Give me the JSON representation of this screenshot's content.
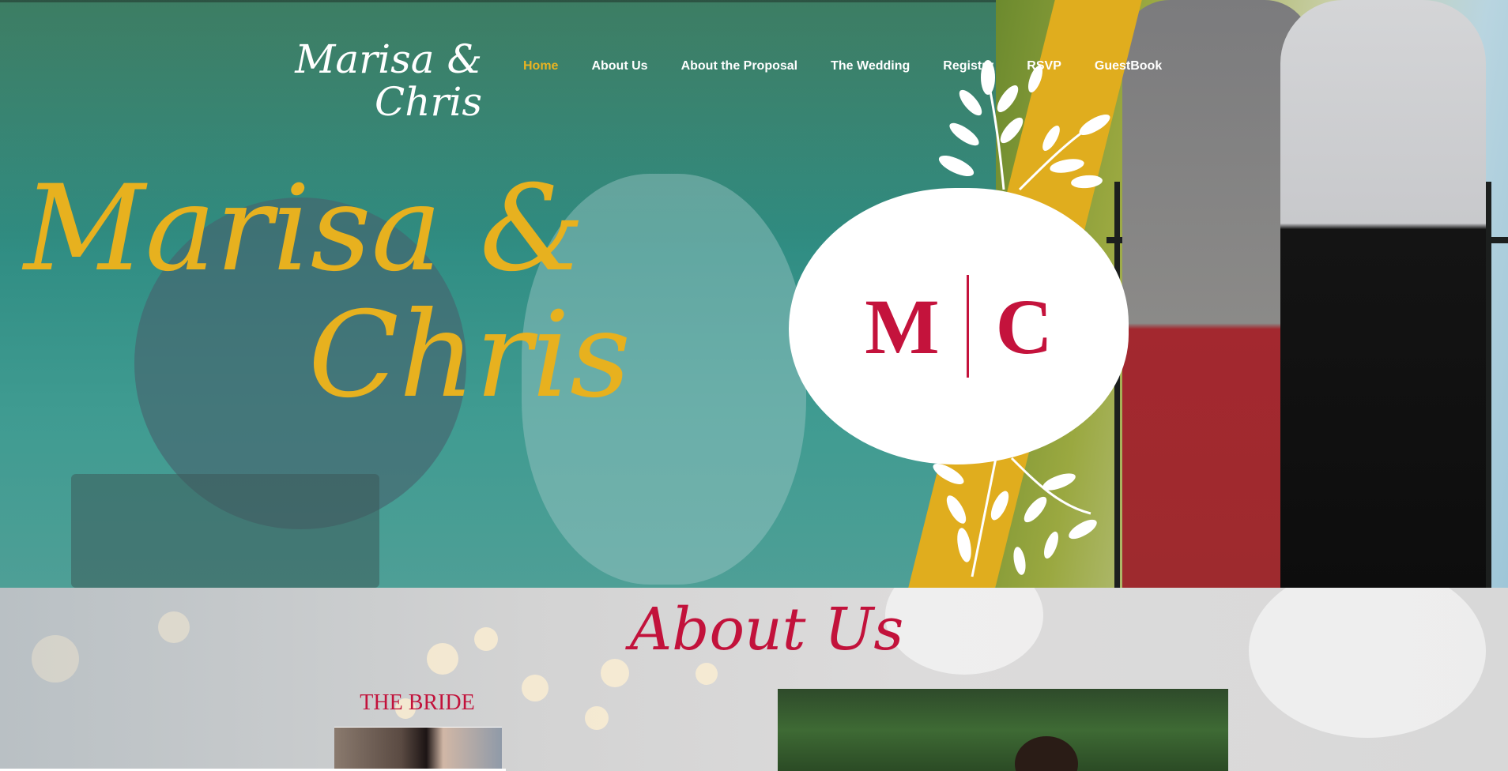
{
  "site": {
    "logo_text_line1": "Marisa &",
    "logo_text_line2": "Chris"
  },
  "nav": {
    "items": [
      {
        "label": "Home",
        "active": true
      },
      {
        "label": "About Us",
        "active": false
      },
      {
        "label": "About the Proposal",
        "active": false
      },
      {
        "label": "The Wedding",
        "active": false
      },
      {
        "label": "Registry",
        "active": false
      },
      {
        "label": "RSVP",
        "active": false
      },
      {
        "label": "GuestBook",
        "active": false
      }
    ]
  },
  "hero": {
    "title_line1": "Marisa &",
    "title_line2": "Chris",
    "monogram_left": "M",
    "monogram_right": "C"
  },
  "about": {
    "title": "About Us",
    "bride_label": "THE BRIDE"
  },
  "colors": {
    "accent_gold": "#e7b11f",
    "brand_red": "#c2123b",
    "teal_overlay": "#2f8c82"
  }
}
